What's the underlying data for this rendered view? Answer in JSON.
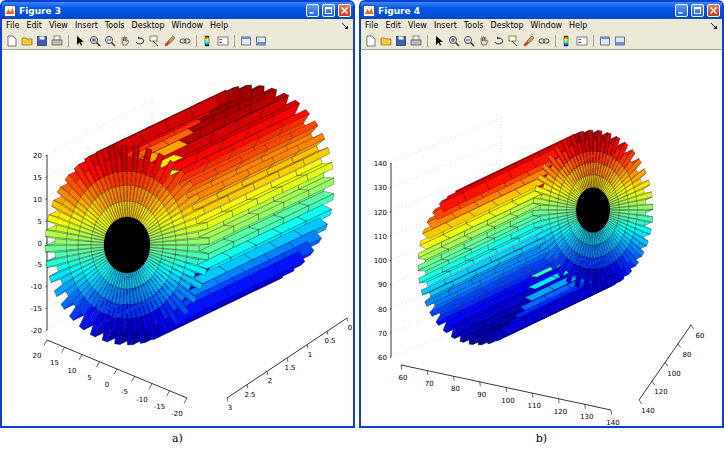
{
  "figures": [
    {
      "window": {
        "title": "Figure 3"
      },
      "menus": [
        "File",
        "Edit",
        "View",
        "Insert",
        "Tools",
        "Desktop",
        "Window",
        "Help"
      ],
      "plot": {
        "z_ticks": [
          "20",
          "15",
          "10",
          "5",
          "0",
          "-5",
          "-10",
          "-15",
          "-20"
        ],
        "x_ticks": [
          "20",
          "15",
          "10",
          "5",
          "0",
          "-5",
          "-10",
          "-15",
          "-20"
        ],
        "y_ticks": [
          "0",
          "0.5",
          "1",
          "1.5",
          "2",
          "2.5",
          "3"
        ],
        "surface": {
          "teeth": 40
        }
      },
      "caption": "a)"
    },
    {
      "window": {
        "title": "Figure 4"
      },
      "menus": [
        "File",
        "Edit",
        "View",
        "Insert",
        "Tools",
        "Desktop",
        "Window",
        "Help"
      ],
      "plot": {
        "z_ticks": [
          "140",
          "130",
          "120",
          "110",
          "100",
          "90",
          "80",
          "70",
          "60"
        ],
        "x_ticks": [
          "60",
          "70",
          "80",
          "90",
          "100",
          "110",
          "120",
          "130",
          "140"
        ],
        "y_ticks": [
          "60",
          "80",
          "100",
          "120",
          "140"
        ],
        "surface": {
          "teeth": 40
        }
      },
      "caption": "b)"
    }
  ]
}
